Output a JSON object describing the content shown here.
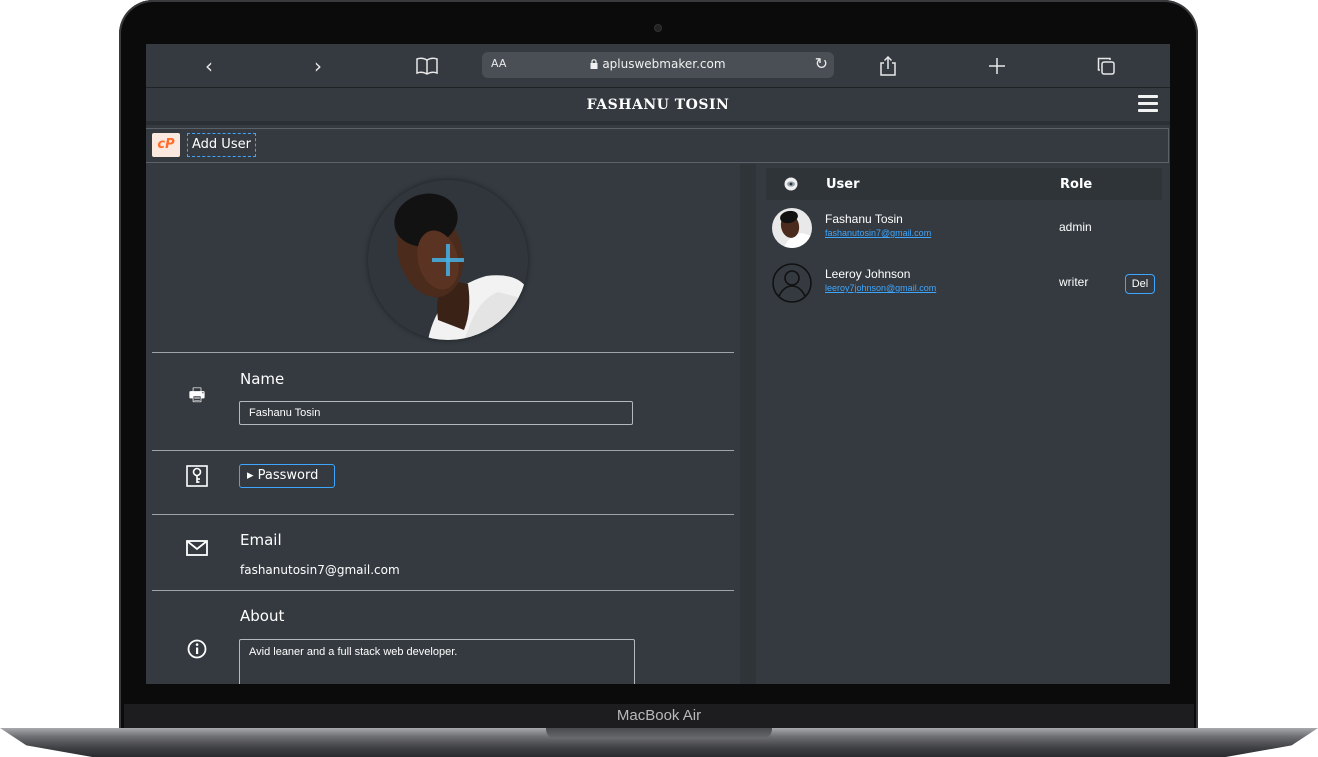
{
  "device": {
    "model_label": "MacBook Air"
  },
  "browser": {
    "url_text_size": "AA",
    "url": "apluswebmaker.com",
    "back_icon": "‹",
    "forward_icon": "›"
  },
  "app": {
    "title": "FASHANU TOSIN",
    "toolbar": {
      "logo_text": "cP",
      "add_user_label": "Add User"
    }
  },
  "profile": {
    "name_label": "Name",
    "name_value": "Fashanu Tosin",
    "password_label": "▸ Password",
    "email_label": "Email",
    "email_value": "fashanutosin7@gmail.com",
    "about_label": "About",
    "about_value": "Avid leaner and a full stack web developer."
  },
  "users_table": {
    "headers": {
      "user": "User",
      "role": "Role"
    },
    "rows": [
      {
        "name": "Fashanu Tosin",
        "email": "fashanutosin7@gmail.com",
        "role": "admin",
        "avatar": "photo"
      },
      {
        "name": "Leeroy Johnson",
        "email": "leeroy7johnson@gmail.com",
        "role": "writer",
        "avatar": "default-user-icon",
        "action": "Del"
      }
    ]
  },
  "colors": {
    "accent": "#3ea6ff",
    "background": "#343a40",
    "cpanel_orange": "#ff6c2c"
  }
}
